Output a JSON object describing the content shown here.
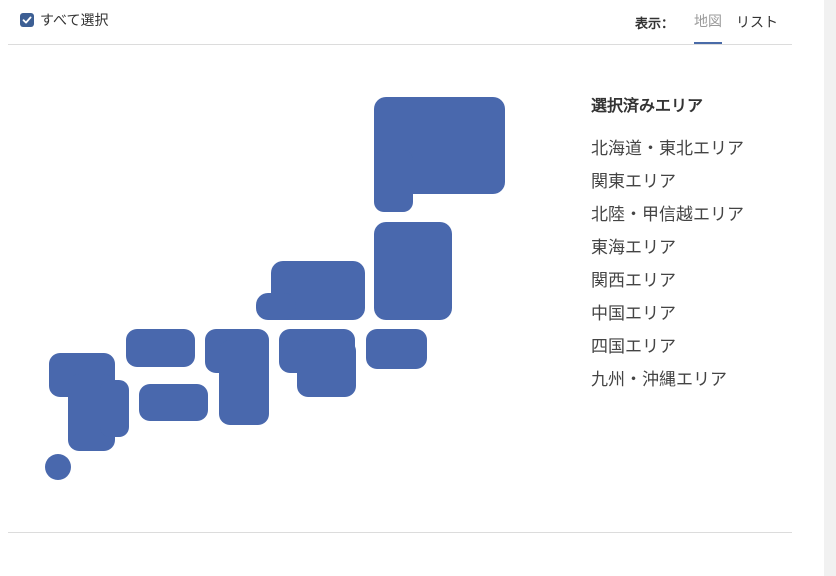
{
  "header": {
    "select_all_label": "すべて選択",
    "select_all_checked": true,
    "view_label": "表示：",
    "tabs": [
      {
        "label": "地図",
        "active": true
      },
      {
        "label": "リスト",
        "active": false
      }
    ]
  },
  "selected": {
    "title": "選択済みエリア",
    "areas": [
      "北海道・東北エリア",
      "関東エリア",
      "北陸・甲信越エリア",
      "東海エリア",
      "関西エリア",
      "中国エリア",
      "四国エリア",
      "九州・沖縄エリア"
    ]
  },
  "colors": {
    "region_fill": "#4968ad",
    "tab_underline": "#4a6ba8",
    "checkbox": "#3d5f94",
    "divider": "#dcdcdc"
  }
}
